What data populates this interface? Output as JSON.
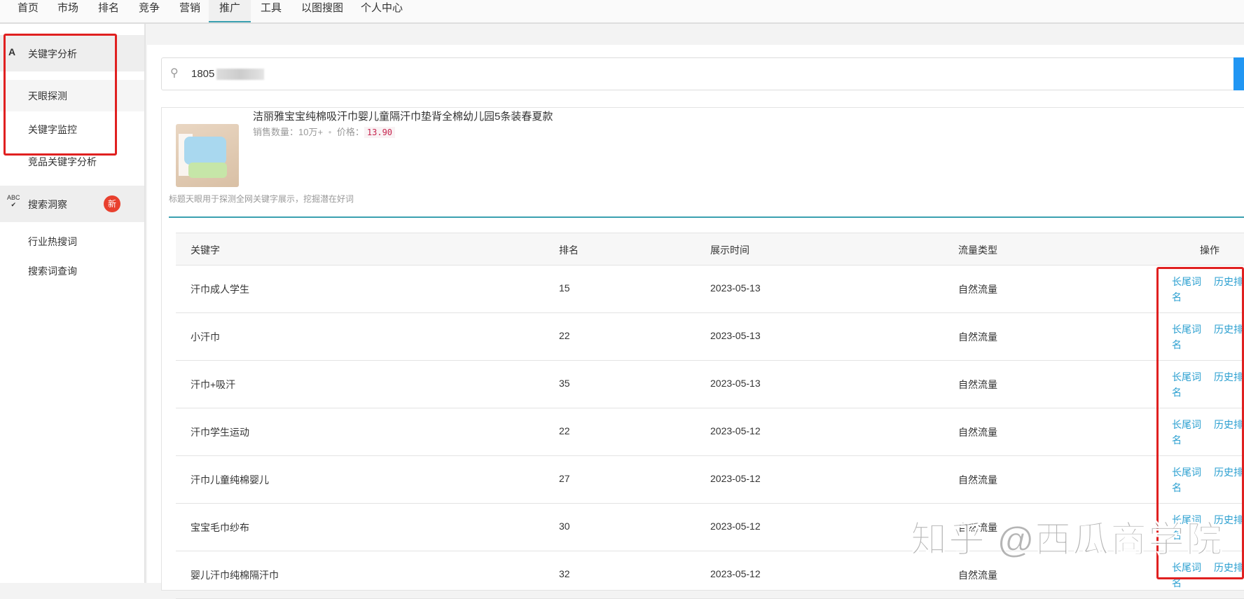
{
  "nav": {
    "items": [
      "首页",
      "市场",
      "排名",
      "竞争",
      "营销",
      "推广",
      "工具",
      "以图搜图",
      "个人中心"
    ],
    "active": "推广"
  },
  "sidebar": {
    "group1": {
      "icon": "A",
      "label": "关键字分析",
      "items": [
        "天眼探测",
        "关键字监控",
        "竞品关键字分析"
      ]
    },
    "group2": {
      "icon": "ABC",
      "label": "搜索洞察",
      "badge": "新",
      "items": [
        "行业热搜词",
        "搜索词查询"
      ]
    }
  },
  "search": {
    "value": "1805"
  },
  "product": {
    "title": "洁丽雅宝宝纯棉吸汗巾婴儿童隔汗巾垫背全棉幼儿园5条装春夏款",
    "sales_label": "销售数量：",
    "sales": "10万+",
    "sep": "•",
    "price_label": "价格：",
    "price": "13.90"
  },
  "hint": "标题天眼用于探测全网关键字展示，挖掘潜在好词",
  "table": {
    "headers": [
      "关键字",
      "排名",
      "展示时间",
      "流量类型",
      "操作"
    ],
    "rows": [
      {
        "keyword": "汗巾成人学生",
        "rank": "15",
        "date": "2023-05-13",
        "type": "自然流量"
      },
      {
        "keyword": "小汗巾",
        "rank": "22",
        "date": "2023-05-13",
        "type": "自然流量"
      },
      {
        "keyword": "汗巾+吸汗",
        "rank": "35",
        "date": "2023-05-13",
        "type": "自然流量"
      },
      {
        "keyword": "汗巾学生运动",
        "rank": "22",
        "date": "2023-05-12",
        "type": "自然流量"
      },
      {
        "keyword": "汗巾儿童纯棉婴儿",
        "rank": "27",
        "date": "2023-05-12",
        "type": "自然流量"
      },
      {
        "keyword": "宝宝毛巾纱布",
        "rank": "30",
        "date": "2023-05-12",
        "type": "自然流量"
      },
      {
        "keyword": "婴儿汗巾纯棉隔汗巾",
        "rank": "32",
        "date": "2023-05-12",
        "type": "自然流量"
      }
    ],
    "ops": [
      "长尾词名",
      "历史排名"
    ]
  },
  "watermark": "知乎 @西瓜商学院",
  "colors": {
    "accent": "#3aa0b0",
    "link": "#2a9fd0",
    "highlight": "#e02020",
    "primary": "#2196f3"
  }
}
